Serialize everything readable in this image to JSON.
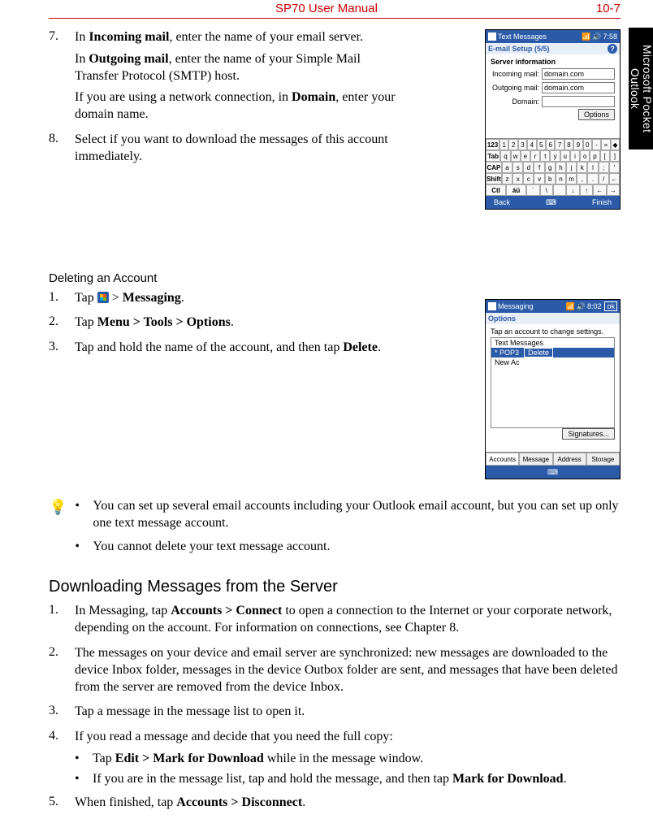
{
  "header": {
    "title": "SP70 User Manual",
    "page": "10-7"
  },
  "side_tab": {
    "line1": "Microsoft Pocket",
    "line2": "Outlook"
  },
  "section1": {
    "steps": [
      {
        "num": "7.",
        "paras": [
          {
            "pre": "In ",
            "b1": "Incoming mail",
            "post": ", enter the name of your email server."
          },
          {
            "pre": "In ",
            "b1": "Outgoing mail",
            "post": ", enter the name of your Simple Mail Transfer Protocol (SMTP) host."
          },
          {
            "pre": "If you are using a network connection, in ",
            "b1": "Domain",
            "post": ", enter your domain name."
          }
        ]
      },
      {
        "num": "8.",
        "paras": [
          {
            "pre": "Select if you want to download the messages of this account immediately.",
            "b1": "",
            "post": ""
          }
        ]
      }
    ]
  },
  "shot1": {
    "title": "Text Messages",
    "time": "7:58",
    "sub": "E-mail Setup (5/5)",
    "heading": "Server information",
    "rows": [
      {
        "label": "Incoming mail:",
        "value": "domain.com"
      },
      {
        "label": "Outgoing mail:",
        "value": "domain.com"
      },
      {
        "label": "Domain:",
        "value": ""
      }
    ],
    "options_btn": "Options",
    "bottom_left": "Back",
    "bottom_right": "Finish",
    "kbd": [
      [
        "123",
        "1",
        "2",
        "3",
        "4",
        "5",
        "6",
        "7",
        "8",
        "9",
        "0",
        "-",
        "=",
        "◆"
      ],
      [
        "Tab",
        "q",
        "w",
        "e",
        "r",
        "t",
        "y",
        "u",
        "i",
        "o",
        "p",
        "[",
        "]"
      ],
      [
        "CAP",
        "a",
        "s",
        "d",
        "f",
        "g",
        "h",
        "j",
        "k",
        "l",
        ";",
        "'"
      ],
      [
        "Shift",
        "z",
        "x",
        "c",
        "v",
        "b",
        "n",
        "m",
        ",",
        ".",
        "/",
        "←"
      ],
      [
        "Ctl",
        "áü",
        "`",
        "\\",
        " ",
        "↓",
        "↑",
        "←",
        "→"
      ]
    ]
  },
  "section2": {
    "heading": "Deleting an Account",
    "steps": [
      {
        "num": "1.",
        "pre": "Tap ",
        "icon": true,
        "post_pre": " > ",
        "b1": "Messaging",
        "post": "."
      },
      {
        "num": "2.",
        "pre": "Tap ",
        "b1": "Menu > Tools > Options",
        "post": "."
      },
      {
        "num": "3.",
        "pre": "Tap and hold the name of the account, and then tap ",
        "b1": "Delete",
        "post": "."
      }
    ]
  },
  "shot2": {
    "title": "Messaging",
    "time": "8:02",
    "ok": "ok",
    "sub": "Options",
    "hint": "Tap an account to change settings.",
    "items": [
      "Text Messages",
      "* POP3",
      "New Ac"
    ],
    "ctx": "Delete",
    "sign_btn": "Signatures...",
    "tabs": [
      "Accounts",
      "Message",
      "Address",
      "Storage"
    ]
  },
  "tips": [
    "You can set up several email accounts including your Outlook email account, but you can set up only one text message account.",
    "You cannot delete your text message account."
  ],
  "section3": {
    "heading": "Downloading Messages from the Server",
    "steps": [
      {
        "num": "1.",
        "pre": "In Messaging, tap ",
        "b1": "Accounts > Connect",
        "post": " to open a connection to the Internet or your corporate network, depending on the account. For information on connections, see Chapter 8."
      },
      {
        "num": "2.",
        "pre": "The messages on your device and email server are synchronized: new messages are downloaded to the device Inbox folder, messages in the device Outbox folder are sent, and messages that have been deleted from the server are removed from the device Inbox.",
        "b1": "",
        "post": ""
      },
      {
        "num": "3.",
        "pre": "Tap a message in the message list to open it.",
        "b1": "",
        "post": ""
      },
      {
        "num": "4.",
        "pre": "If you read a message and decide that you need the full copy:",
        "b1": "",
        "post": "",
        "subs": [
          {
            "pre": "Tap ",
            "b1": "Edit > Mark for Download",
            "post": " while in the message window."
          },
          {
            "pre": "If you are in the message list, tap and hold the message, and then tap ",
            "b1": "Mark for Download",
            "post": "."
          }
        ]
      },
      {
        "num": "5.",
        "pre": "When finished, tap ",
        "b1": "Accounts > Disconnect",
        "post": "."
      }
    ]
  }
}
